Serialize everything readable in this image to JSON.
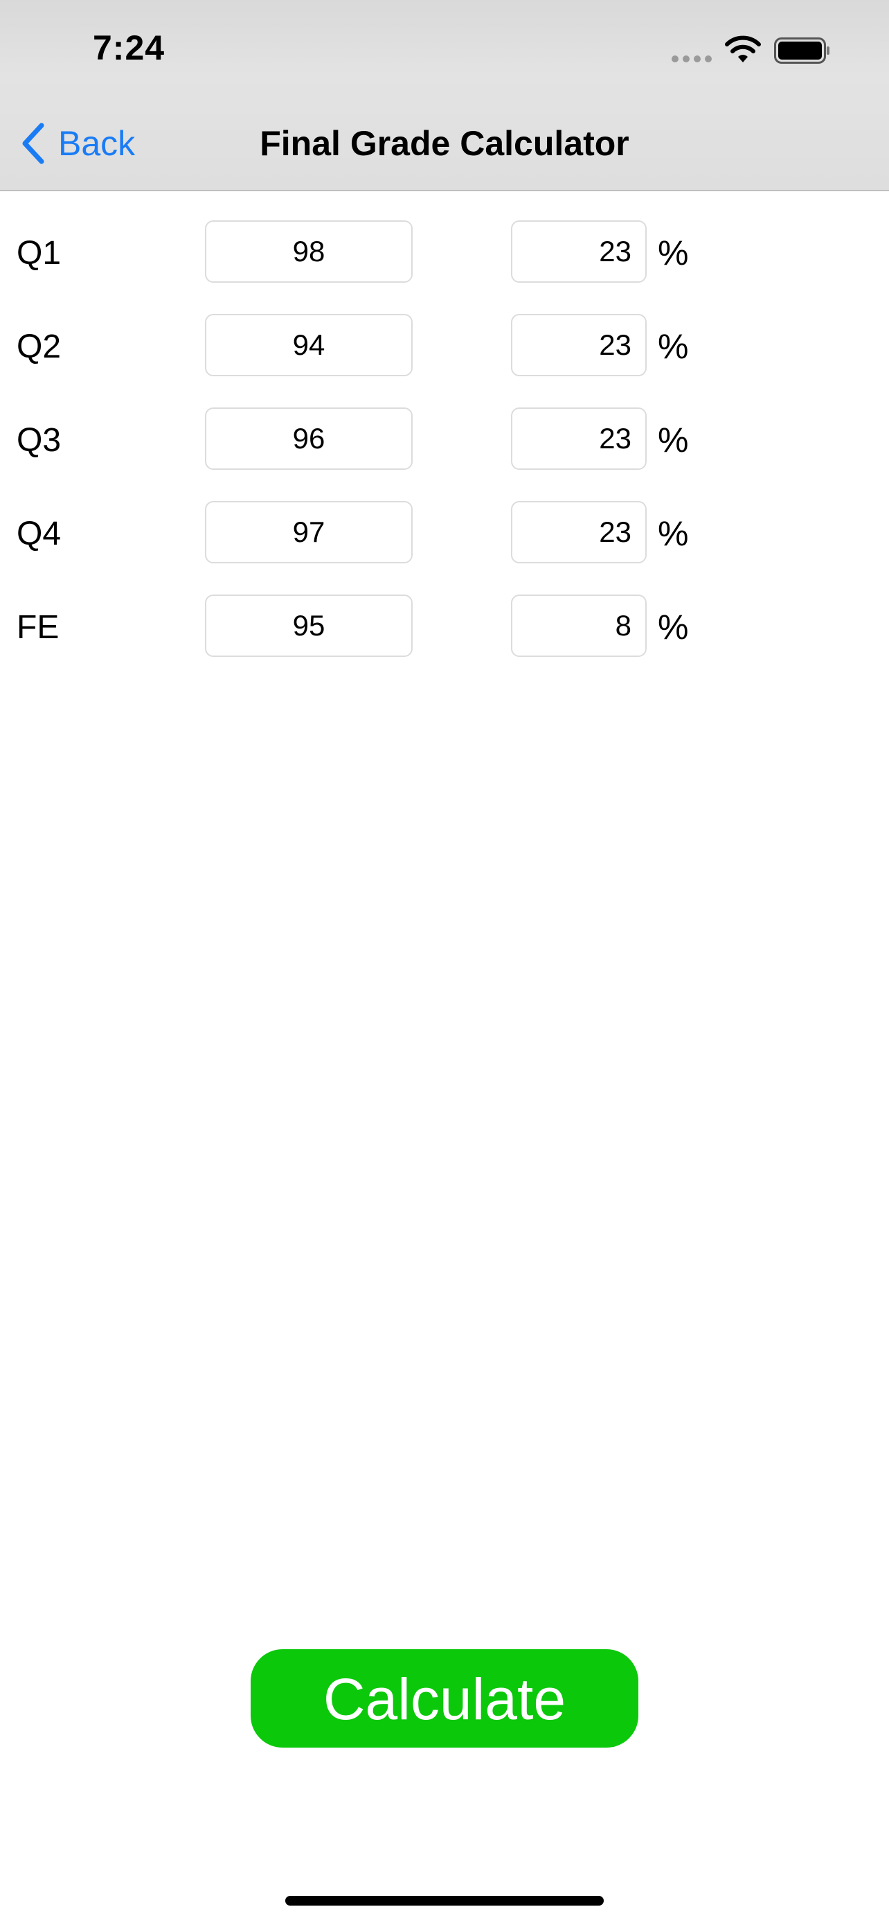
{
  "status_bar": {
    "time": "7:24"
  },
  "nav": {
    "back_label": "Back",
    "title": "Final Grade Calculator"
  },
  "rows": [
    {
      "label": "Q1",
      "score": "98",
      "weight": "23",
      "unit": "%"
    },
    {
      "label": "Q2",
      "score": "94",
      "weight": "23",
      "unit": "%"
    },
    {
      "label": "Q3",
      "score": "96",
      "weight": "23",
      "unit": "%"
    },
    {
      "label": "Q4",
      "score": "97",
      "weight": "23",
      "unit": "%"
    },
    {
      "label": "FE",
      "score": "95",
      "weight": "8",
      "unit": "%"
    }
  ],
  "calculate_button": {
    "label": "Calculate"
  },
  "colors": {
    "accent": "#1a7cf5",
    "button": "#0bc80b",
    "header_bg": "#dedede"
  },
  "icons": {
    "back": "chevron-left-icon",
    "signal": "cellular-signal-icon",
    "wifi": "wifi-icon",
    "battery": "battery-icon"
  }
}
